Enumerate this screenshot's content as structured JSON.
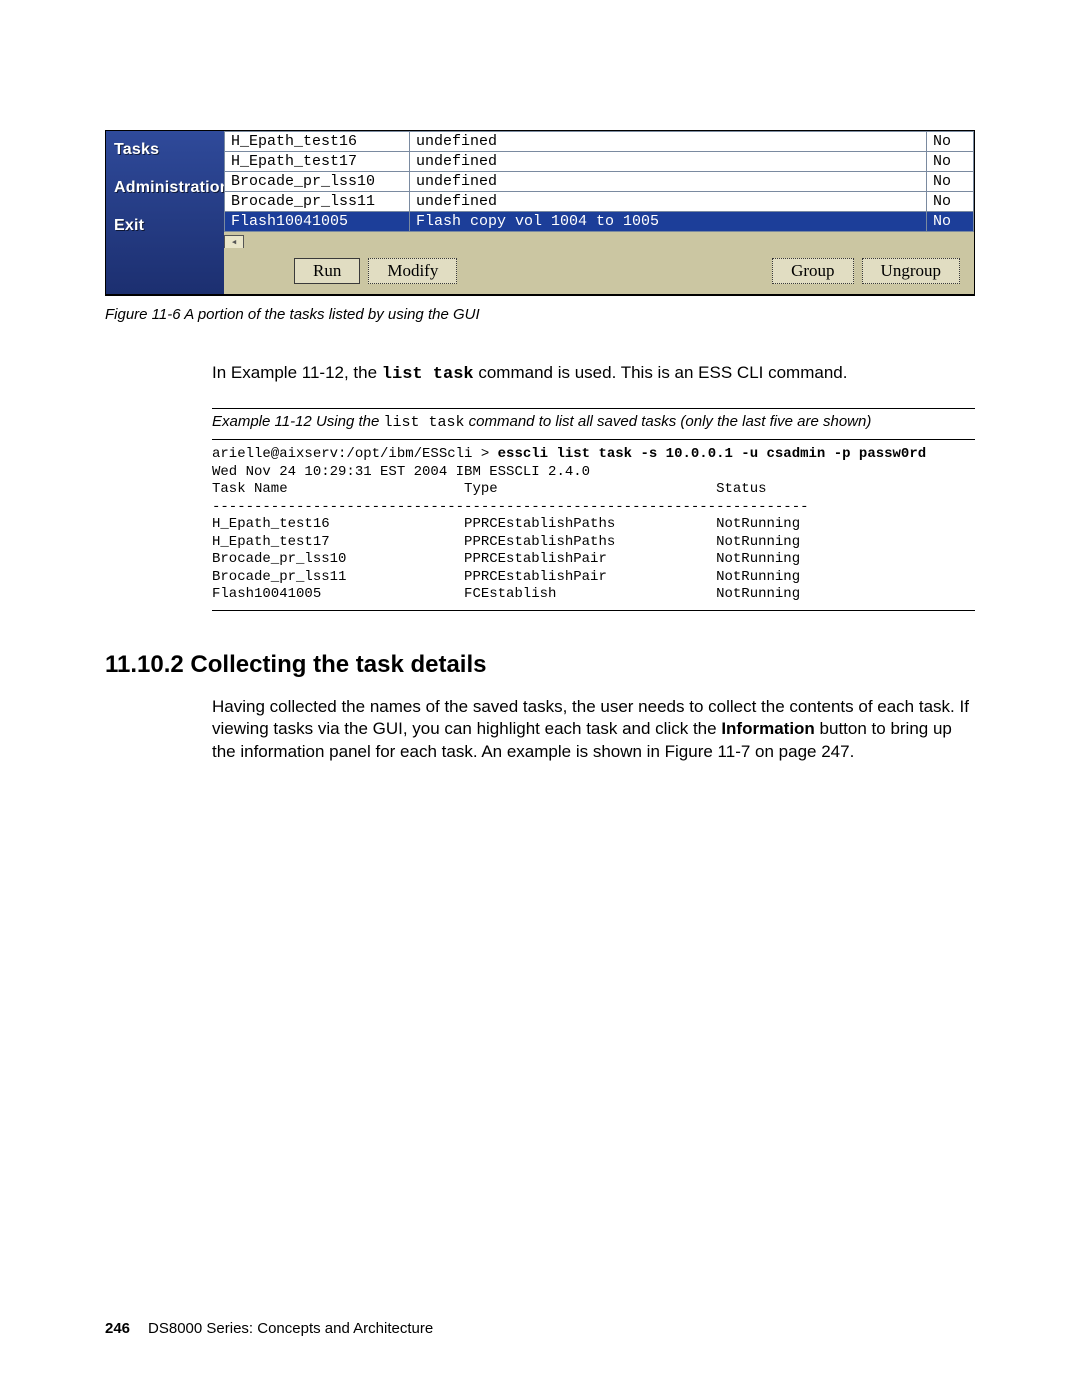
{
  "gui": {
    "sidebar": [
      "Tasks",
      "Administration",
      "Exit"
    ],
    "rows": [
      {
        "name": "H_Epath_test16",
        "desc": "undefined",
        "flag": "No",
        "sel": false
      },
      {
        "name": "H_Epath_test17",
        "desc": "undefined",
        "flag": "No",
        "sel": false
      },
      {
        "name": "Brocade_pr_lss10",
        "desc": "undefined",
        "flag": "No",
        "sel": false
      },
      {
        "name": "Brocade_pr_lss11",
        "desc": "undefined",
        "flag": "No",
        "sel": false
      },
      {
        "name": "Flash10041005",
        "desc": "Flash copy vol 1004 to 1005",
        "flag": "No",
        "sel": true
      }
    ],
    "buttons": {
      "run": "Run",
      "modify": "Modify",
      "group": "Group",
      "ungroup": "Ungroup"
    }
  },
  "fig_caption": "Figure 11-6   A portion of the tasks listed by using the GUI",
  "para1_a": "In Example 11-12, the ",
  "para1_cmd": "list task",
  "para1_b": " command is used. This is an ESS CLI command.",
  "example_caption_a": "Example 11-12   Using the ",
  "example_caption_cmd": "list task",
  "example_caption_b": " command to list all saved tasks (only the last five are shown)",
  "code": {
    "prompt": "arielle@aixserv:/opt/ibm/ESScli > ",
    "cmd": "esscli list task -s 10.0.0.1 -u csadmin -p passw0rd",
    "line2": "Wed Nov 24 10:29:31 EST 2004 IBM ESSCLI 2.4.0",
    "hdr": "Task Name                     Type                          Status",
    "rule": "-----------------------------------------------------------------------",
    "r1": "H_Epath_test16                PPRCEstablishPaths            NotRunning",
    "r2": "H_Epath_test17                PPRCEstablishPaths            NotRunning",
    "r3": "Brocade_pr_lss10              PPRCEstablishPair             NotRunning",
    "r4": "Brocade_pr_lss11              PPRCEstablishPair             NotRunning",
    "r5": "Flash10041005                 FCEstablish                   NotRunning"
  },
  "section_heading": "11.10.2  Collecting the task details",
  "para2": "Having collected the names of the saved tasks, the user needs to collect the contents of each task. If viewing tasks via the GUI, you can highlight each task and click the Information button to bring up the information panel for each task. An example is shown in Figure 11-7 on page 247.",
  "footer": {
    "page": "246",
    "title": "DS8000 Series: Concepts and Architecture"
  }
}
